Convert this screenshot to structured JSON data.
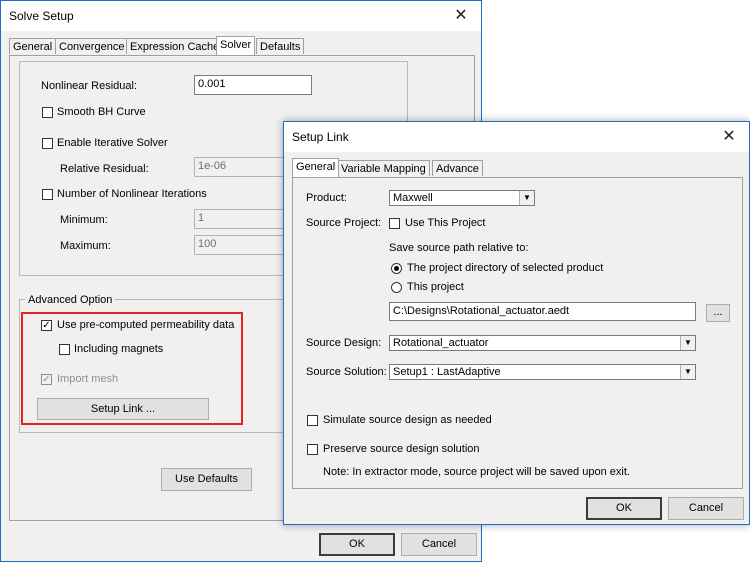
{
  "solve_setup": {
    "title": "Solve Setup",
    "tabs": [
      "General",
      "Convergence",
      "Expression Cache",
      "Solver",
      "Defaults"
    ],
    "nonlinear_residual": {
      "label": "Nonlinear Residual:",
      "value": "0.001"
    },
    "smooth_bh": "Smooth BH Curve",
    "enable_iterative": "Enable Iterative Solver",
    "relative_residual": {
      "label": "Relative Residual:",
      "value": "1e-06"
    },
    "num_nonlinear": "Number of Nonlinear Iterations",
    "minimum": {
      "label": "Minimum:",
      "value": "1"
    },
    "maximum": {
      "label": "Maximum:",
      "value": "100"
    },
    "advanced_option": "Advanced Option",
    "use_precomputed": "Use pre-computed permeability data",
    "including_magnets": "Including magnets",
    "import_mesh": "Import mesh",
    "setup_link_btn": "Setup Link ...",
    "use_defaults": "Use Defaults",
    "ok": "OK",
    "cancel": "Cancel",
    "highlight_color": "#e32222"
  },
  "setup_link": {
    "title": "Setup Link",
    "tabs": [
      "General",
      "Variable Mapping",
      "Advance"
    ],
    "product": {
      "label": "Product:",
      "value": "Maxwell"
    },
    "source_project": {
      "label": "Source Project:",
      "use_this": "Use This Project"
    },
    "save_relative": "Save source path relative to:",
    "radio_project_dir": "The project directory of selected product",
    "radio_this_project": "This project",
    "path_value": "C:\\Designs\\Rotational_actuator.aedt",
    "browse": "...",
    "source_design": {
      "label": "Source Design:",
      "value": "Rotational_actuator"
    },
    "source_solution": {
      "label": "Source Solution:",
      "value": "Setup1 : LastAdaptive"
    },
    "simulate": "Simulate source design as needed",
    "preserve": "Preserve source design solution",
    "note": "Note: In extractor mode, source project will be saved upon exit.",
    "ok": "OK",
    "cancel": "Cancel"
  }
}
